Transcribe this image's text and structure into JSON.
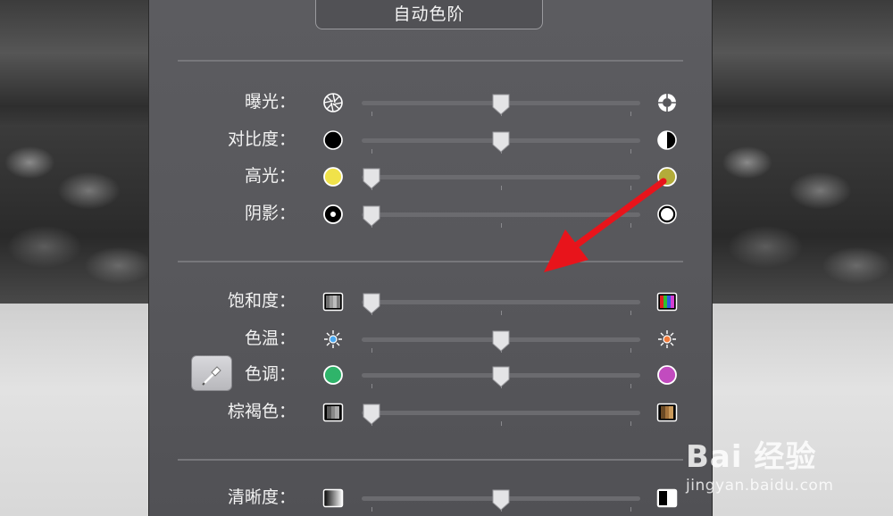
{
  "panel": {
    "auto_levels_label": "自动色阶"
  },
  "sliders": [
    {
      "id": "exposure",
      "label": "曝光：",
      "value": 0.5,
      "icon_left": "aperture-closed-icon",
      "icon_right": "aperture-open-icon"
    },
    {
      "id": "contrast",
      "label": "对比度：",
      "value": 0.5,
      "icon_left": "black-circle-icon",
      "icon_right": "half-circle-icon"
    },
    {
      "id": "highlights",
      "label": "高光：",
      "value": 0.0,
      "icon_left": "yellow-circle-icon",
      "icon_right": "olive-circle-icon"
    },
    {
      "id": "shadows",
      "label": "阴影：",
      "value": 0.0,
      "icon_left": "dot-circle-icon",
      "icon_right": "white-circle-icon"
    },
    {
      "id": "saturation",
      "label": "饱和度：",
      "value": 0.0,
      "icon_left": "gray-stripes-icon",
      "icon_right": "color-stripes-icon"
    },
    {
      "id": "temperature",
      "label": "色温：",
      "value": 0.5,
      "icon_left": "blue-sun-icon",
      "icon_right": "orange-sun-icon"
    },
    {
      "id": "tint",
      "label": "色调：",
      "value": 0.5,
      "icon_left": "green-circle-icon",
      "icon_right": "magenta-circle-icon"
    },
    {
      "id": "sepia",
      "label": "棕褐色：",
      "value": 0.0,
      "icon_left": "gray-box-icon",
      "icon_right": "sepia-box-icon"
    },
    {
      "id": "sharpness",
      "label": "清晰度：",
      "value": 0.5,
      "icon_left": "sharp-gradient-icon",
      "icon_right": "blur-gradient-icon"
    }
  ],
  "colors": {
    "accent_arrow": "#e8141b",
    "panel_bg": "#58585c"
  },
  "watermark": {
    "brand": "Bai 经验",
    "url": "jingyan.baidu.com"
  }
}
